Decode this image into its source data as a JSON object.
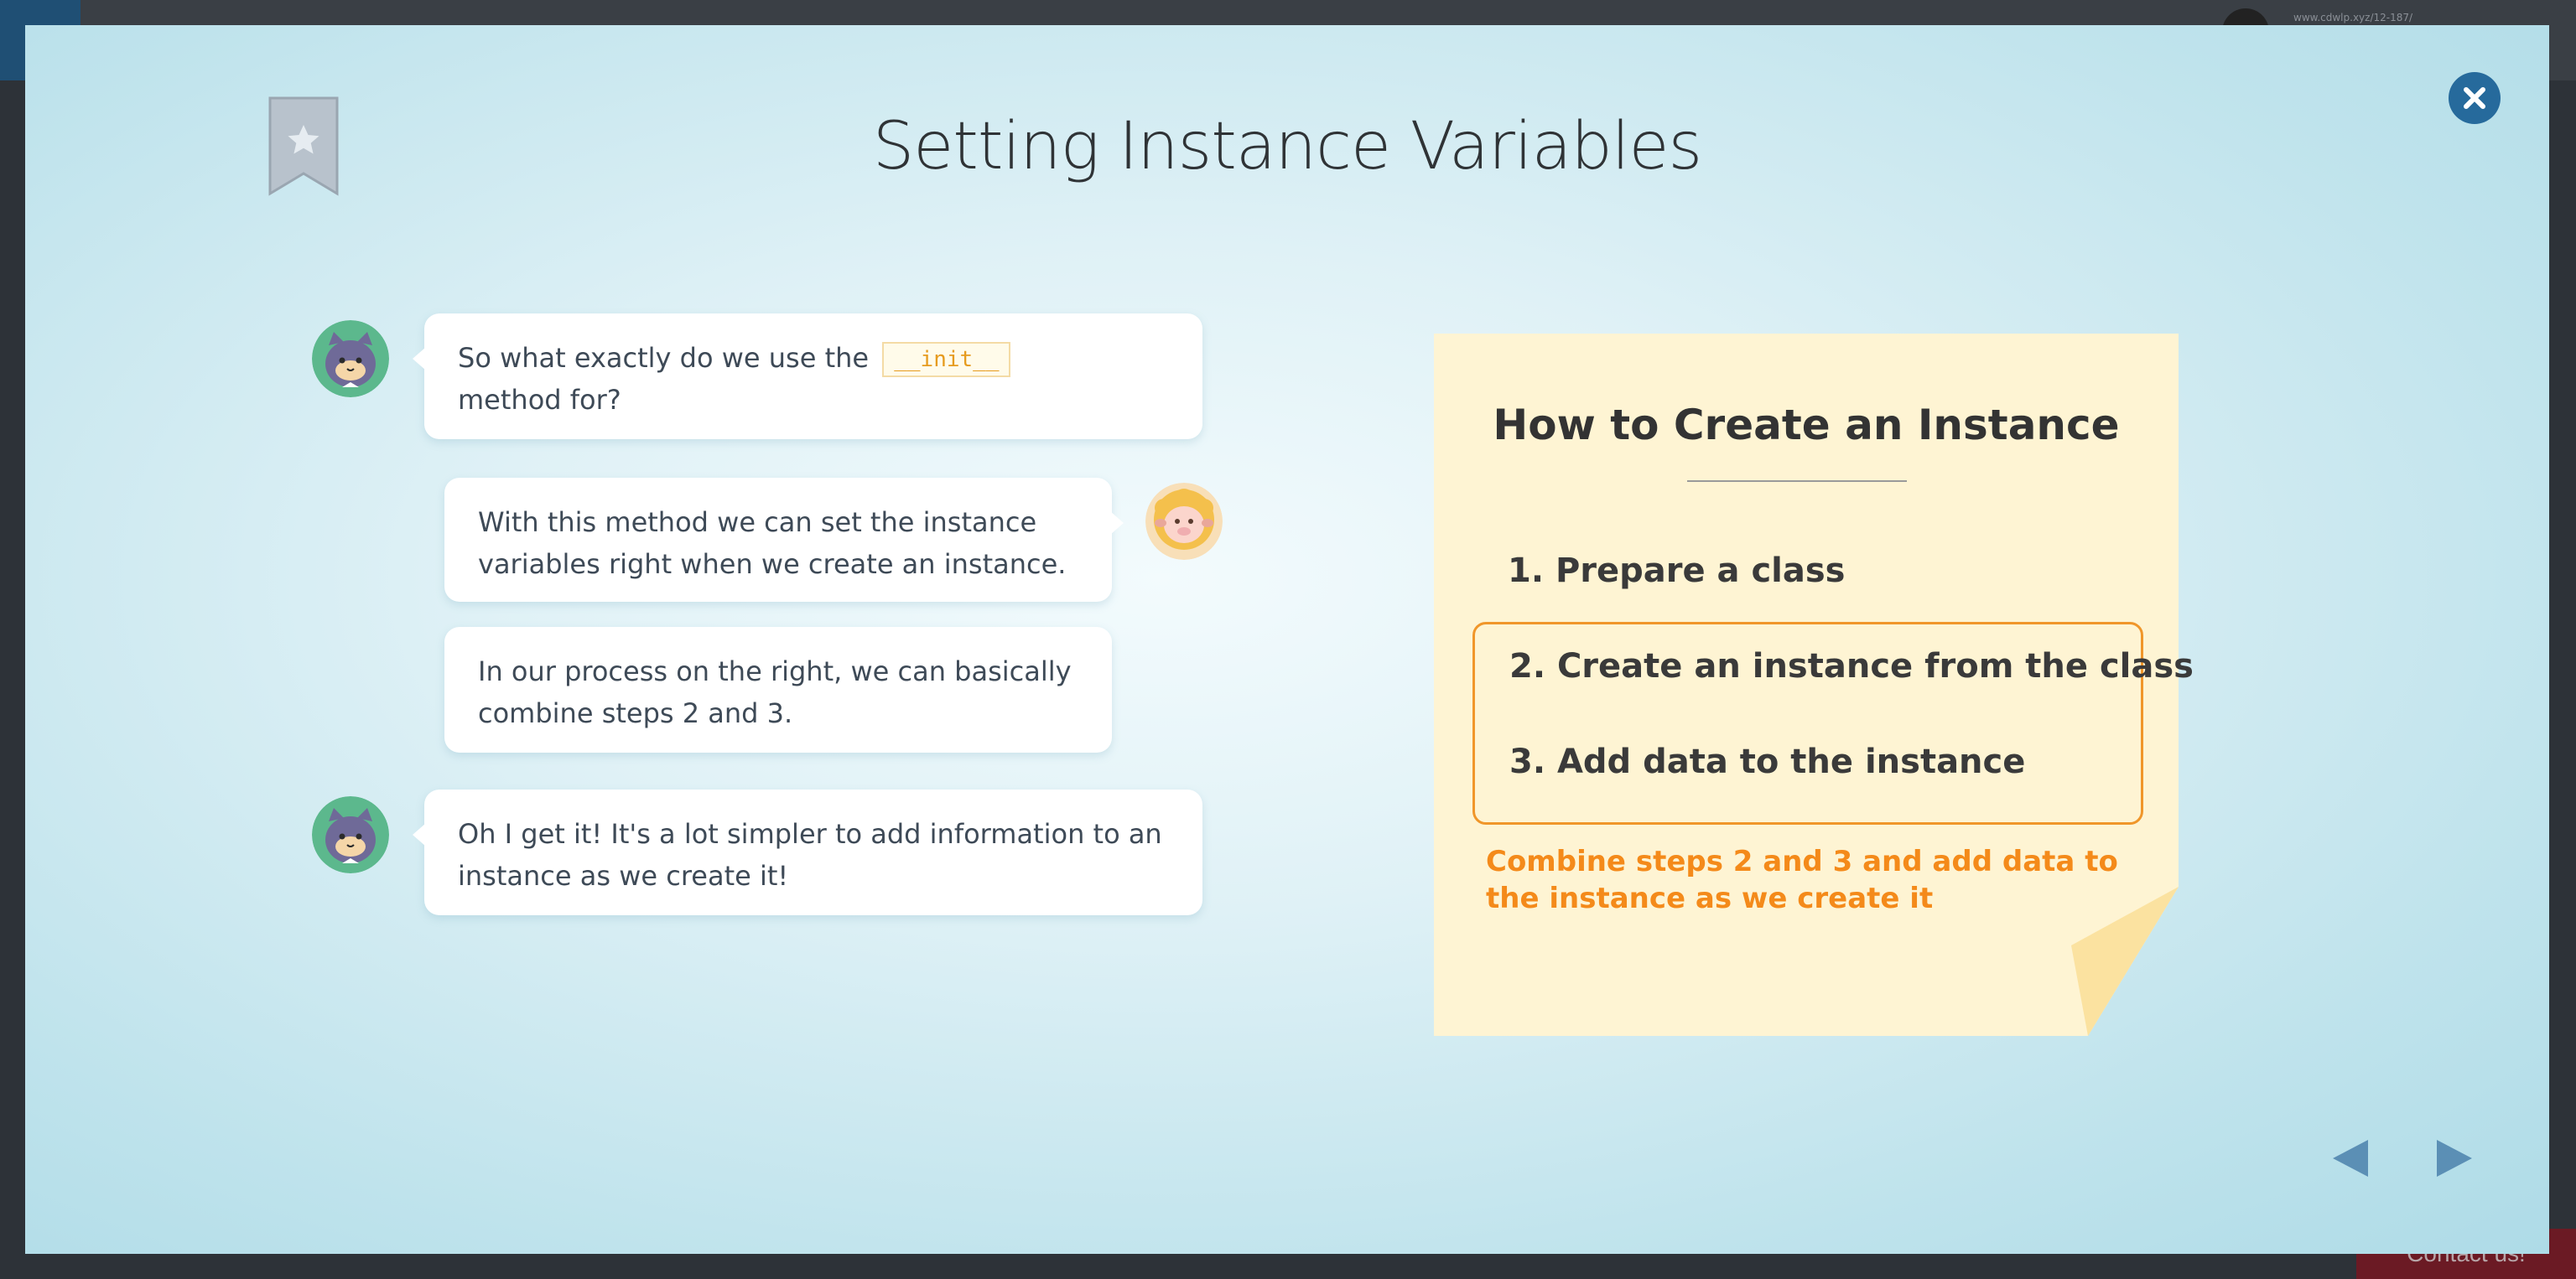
{
  "background_page": {
    "site_text": "www.cdwlp.xyz/12-187/",
    "contact_label": "Contact us!"
  },
  "lesson": {
    "title": "Setting Instance Variables",
    "close_icon": "close-icon",
    "bookmark_icon": "bookmark-star-icon"
  },
  "chat": {
    "messages": [
      {
        "speaker": "cat",
        "text_before": "So what exactly do we use the",
        "code": "__init__",
        "text_after": "method for?"
      },
      {
        "speaker": "sheep",
        "text": "With this method we can set the instance variables right when we create an instance."
      },
      {
        "speaker": "sheep",
        "text": "In our process on the right, we can basically combine steps 2 and 3."
      },
      {
        "speaker": "cat",
        "text": "Oh I get it! It's a lot simpler to add information to an instance as we create it!"
      }
    ]
  },
  "note": {
    "title": "How to Create an Instance",
    "steps": [
      "1. Prepare a class",
      "2. Create an instance from the class",
      "3. Add data to the instance"
    ],
    "footer": "Combine steps 2 and 3 and add data to the instance as we create it",
    "background_color": "#fef4d3",
    "accent_color": "#f0962a"
  },
  "navigation": {
    "prev_icon": "triangle-left-icon",
    "next_icon": "triangle-right-icon",
    "arrow_color": "#5b8fb5"
  }
}
